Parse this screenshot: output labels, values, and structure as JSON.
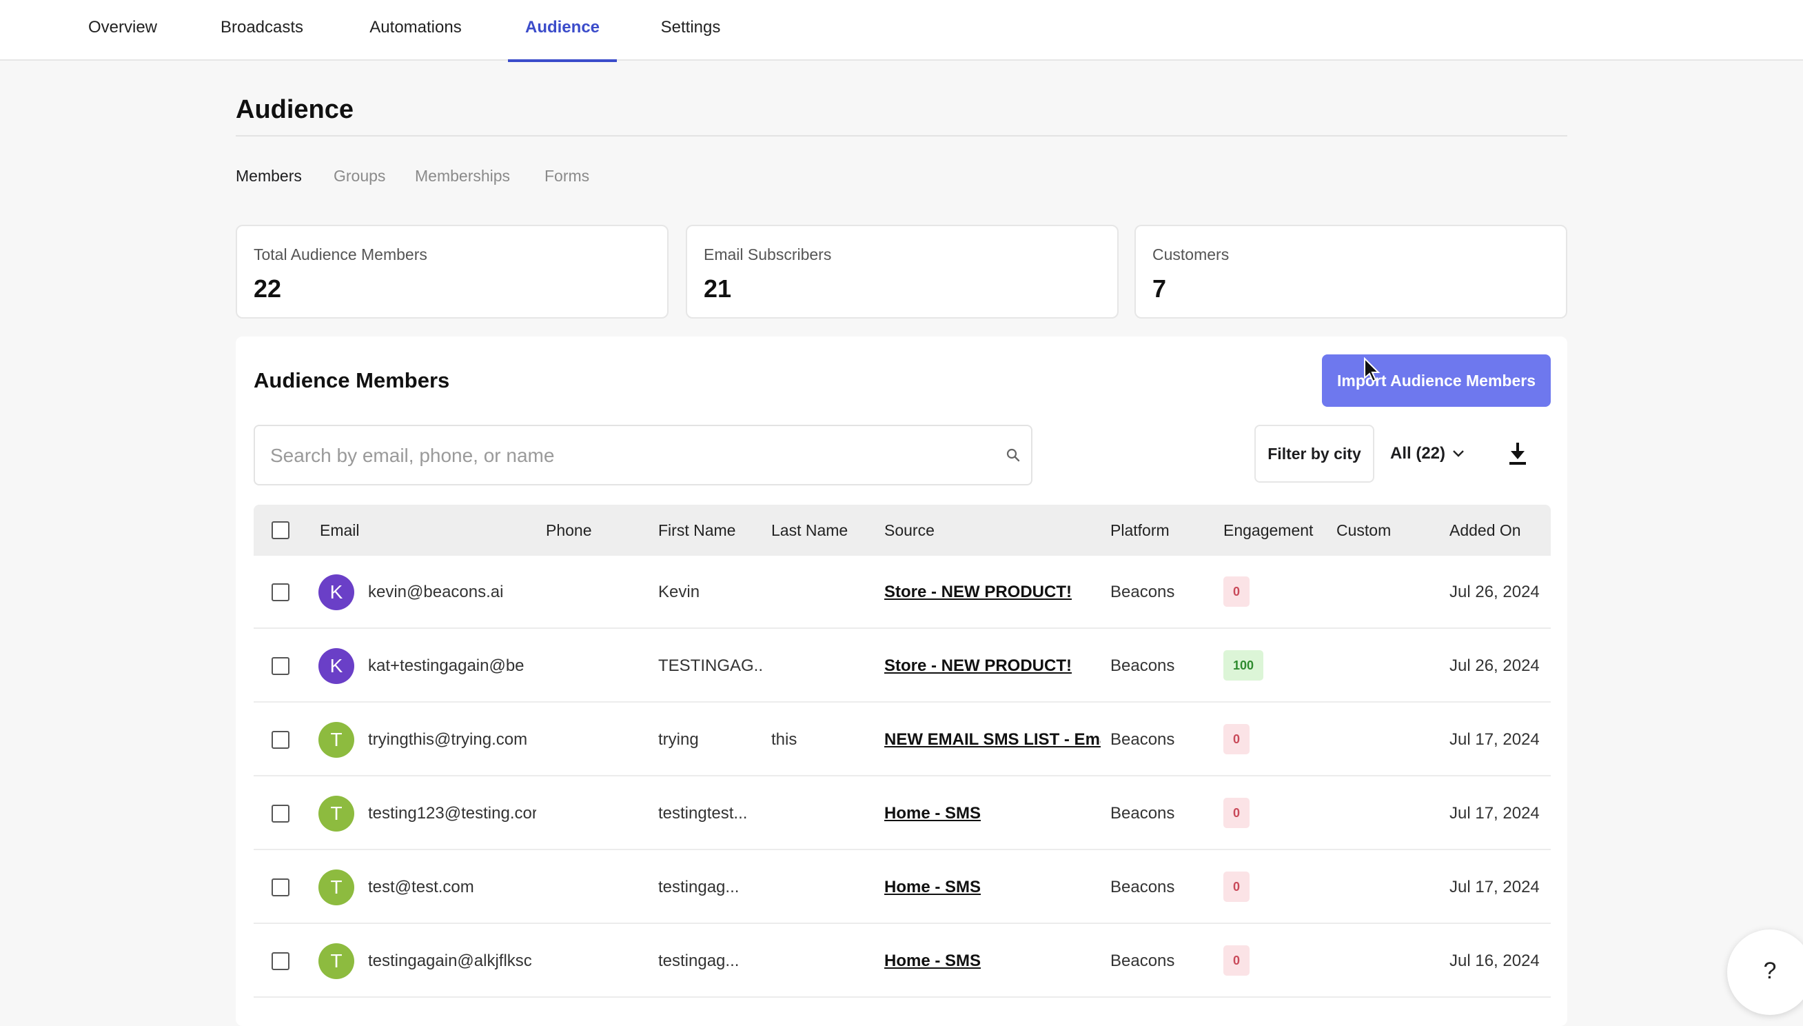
{
  "nav": {
    "tabs": [
      {
        "label": "Overview"
      },
      {
        "label": "Broadcasts"
      },
      {
        "label": "Automations"
      },
      {
        "label": "Audience"
      },
      {
        "label": "Settings"
      }
    ]
  },
  "page": {
    "title": "Audience",
    "subtabs": [
      {
        "label": "Members"
      },
      {
        "label": "Groups"
      },
      {
        "label": "Memberships"
      },
      {
        "label": "Forms"
      }
    ]
  },
  "stats": [
    {
      "label": "Total Audience Members",
      "value": "22"
    },
    {
      "label": "Email Subscribers",
      "value": "21"
    },
    {
      "label": "Customers",
      "value": "7"
    }
  ],
  "members_panel": {
    "title": "Audience Members",
    "import_label": "Import Audience Members",
    "search_placeholder": "Search by email, phone, or name",
    "filter_label": "Filter by city",
    "all_label": "All (22)"
  },
  "table": {
    "headers": {
      "email": "Email",
      "phone": "Phone",
      "first_name": "First Name",
      "last_name": "Last Name",
      "source": "Source",
      "platform": "Platform",
      "engagement": "Engagement",
      "custom": "Custom",
      "added_on": "Added On"
    },
    "rows": [
      {
        "initial": "K",
        "avatar_color": "#6a3fc7",
        "email": "kevin@beacons.ai",
        "phone": "",
        "first_name": "Kevin",
        "last_name": "",
        "source": "Store - NEW PRODUCT!",
        "platform": "Beacons",
        "engagement": "0",
        "added_on": "Jul 26, 2024"
      },
      {
        "initial": "K",
        "avatar_color": "#6a3fc7",
        "email": "kat+testingagain@be",
        "phone": "",
        "first_name": "TESTINGAG...",
        "last_name": "",
        "source": "Store - NEW PRODUCT!",
        "platform": "Beacons",
        "engagement": "100",
        "added_on": "Jul 26, 2024"
      },
      {
        "initial": "T",
        "avatar_color": "#8dbb3f",
        "email": "tryingthis@trying.com",
        "phone": "",
        "first_name": "trying",
        "last_name": "this",
        "source": "NEW EMAIL SMS LIST - Email &",
        "platform": "Beacons",
        "engagement": "0",
        "added_on": "Jul 17, 2024"
      },
      {
        "initial": "T",
        "avatar_color": "#8dbb3f",
        "email": "testing123@testing.cor",
        "phone": "",
        "first_name": "testingtest...",
        "last_name": "",
        "source": "Home - SMS",
        "platform": "Beacons",
        "engagement": "0",
        "added_on": "Jul 17, 2024"
      },
      {
        "initial": "T",
        "avatar_color": "#8dbb3f",
        "email": "test@test.com",
        "phone": "",
        "first_name": "testingag...",
        "last_name": "",
        "source": "Home - SMS",
        "platform": "Beacons",
        "engagement": "0",
        "added_on": "Jul 17, 2024"
      },
      {
        "initial": "T",
        "avatar_color": "#8dbb3f",
        "email": "testingagain@alkjflksc",
        "phone": "",
        "first_name": "testingag...",
        "last_name": "",
        "source": "Home - SMS",
        "platform": "Beacons",
        "engagement": "0",
        "added_on": "Jul 16, 2024"
      }
    ]
  },
  "help": {
    "label": "?"
  },
  "colors": {
    "accent": "#3b4cca",
    "import_button": "#6e78ee",
    "badge_zero_bg": "#fbe3e6",
    "badge_zero_text": "#c94a5a",
    "badge_high_bg": "#dcf5d7",
    "badge_high_text": "#2e8b2e"
  }
}
